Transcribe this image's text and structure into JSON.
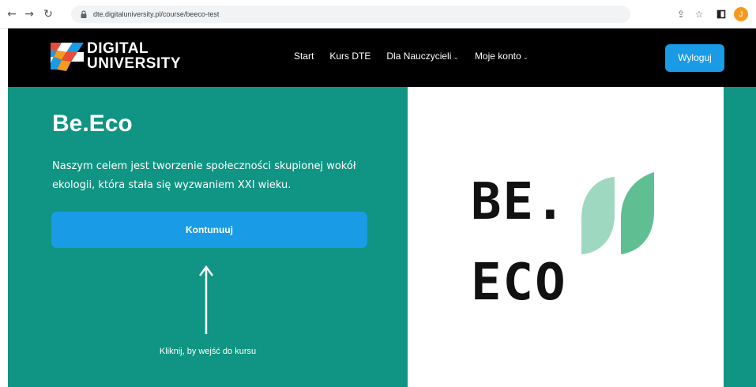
{
  "browser": {
    "url": "dte.digitaluniversity.pl/course/beeco-test",
    "profile_initial": "J"
  },
  "header": {
    "logo": {
      "line1": "DIGITAL",
      "line2": "UNIVERSITY"
    },
    "nav": [
      {
        "label": "Start",
        "dropdown": false
      },
      {
        "label": "Kurs DTE",
        "dropdown": false
      },
      {
        "label": "Dla Nauczycieli",
        "dropdown": true
      },
      {
        "label": "Moje konto",
        "dropdown": true
      }
    ],
    "logout_label": "Wyloguj"
  },
  "hero": {
    "title": "Be.Eco",
    "description": "Naszym celem jest tworzenie społeczności skupionej wokół ekologii, która stała się wyzwaniem XXI wieku.",
    "continue_label": "Kontunuuj",
    "hint": "Kliknij, by wejść do kursu"
  },
  "brand": {
    "line1": "BE.",
    "line2": "ECO"
  },
  "colors": {
    "teal": "#109483",
    "blue": "#1a9be6",
    "leaf_light": "#9ed8c0",
    "leaf_dark": "#5fbf92"
  },
  "icons": [
    "back-arrow-icon",
    "forward-arrow-icon",
    "reload-icon",
    "lock-icon",
    "share-icon",
    "star-icon",
    "sidebar-icon",
    "arrow-up-icon",
    "leaf-icon"
  ]
}
